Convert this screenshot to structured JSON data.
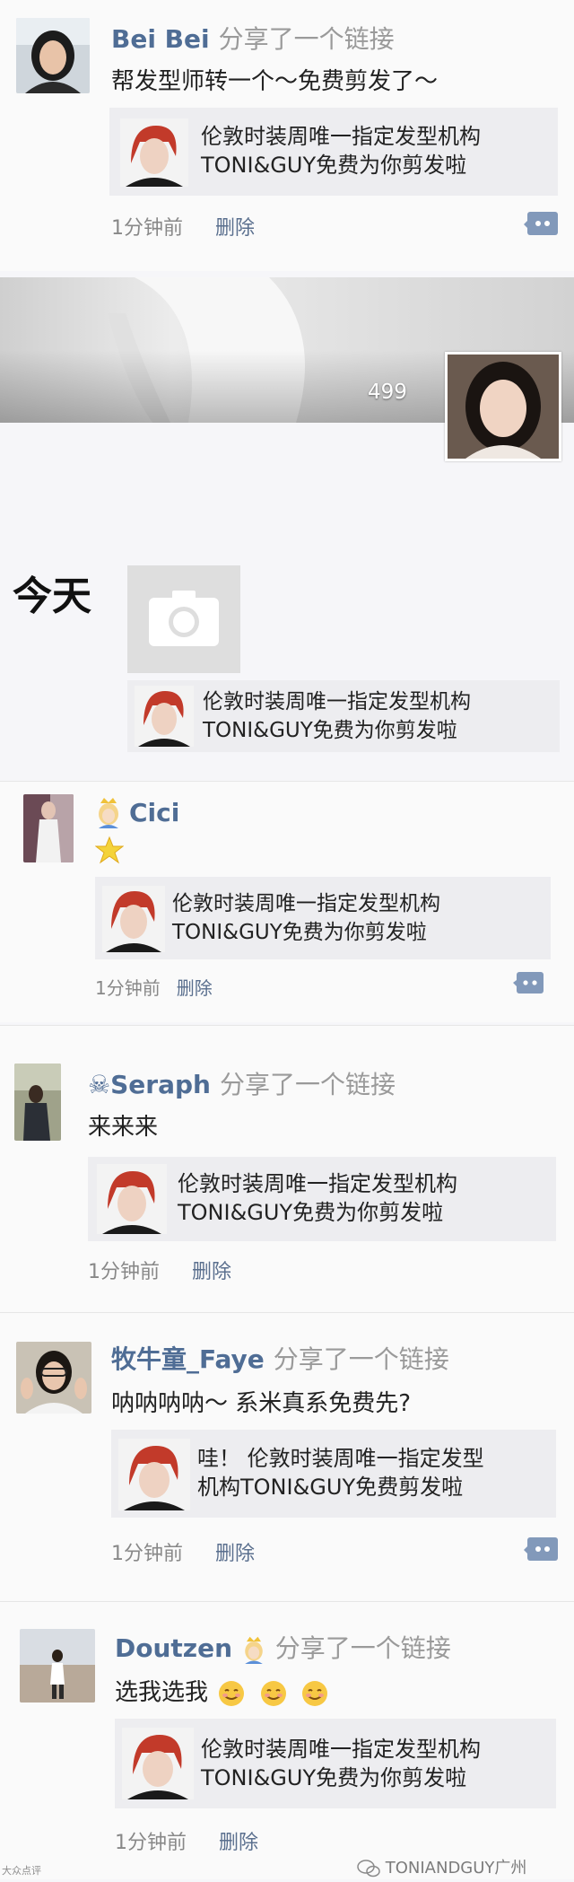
{
  "card": {
    "line1": "伦敦时装周唯一指定发型机构",
    "line2": "TONI&GUY免费为你剪发啦"
  },
  "posts": [
    {
      "name": "Bei Bei",
      "action": "分享了一个链接",
      "text": "帮发型师转一个～免费剪发了～",
      "time": "1分钟前",
      "delete": "删除"
    },
    {
      "name": "Cici",
      "time": "1分钟前",
      "delete": "删除"
    },
    {
      "name": "☠Seraph",
      "action": "分享了一个链接",
      "text": "来来来",
      "time": "1分钟前",
      "delete": "删除"
    },
    {
      "name": "牧牛童_Faye",
      "action": "分享了一个链接",
      "text": "呐呐呐呐～ 系米真系免费先?",
      "card_line1": "哇！ 伦敦时装周唯一指定发型",
      "card_line2": "机构TONI&GUY免费剪发啦",
      "time": "1分钟前",
      "delete": "删除"
    },
    {
      "name": "Doutzen",
      "action": "分享了一个链接",
      "text": "选我选我",
      "time": "1分钟前",
      "delete": "删除"
    }
  ],
  "cover": {
    "count": "499"
  },
  "today": {
    "label": "今天"
  },
  "watermark": {
    "label": "TONIANDGUY广州"
  },
  "corner_mark": {
    "label": "大众点评"
  },
  "icons": {
    "comment": "comment-icon",
    "camera": "camera-icon",
    "crown": "crown-emoji-icon",
    "star": "star-icon",
    "smile": "smile-emoji-icon"
  },
  "colors": {
    "name": "#4f6d95",
    "card_bg": "#ededf0",
    "comment_icon": "#8299ba"
  }
}
